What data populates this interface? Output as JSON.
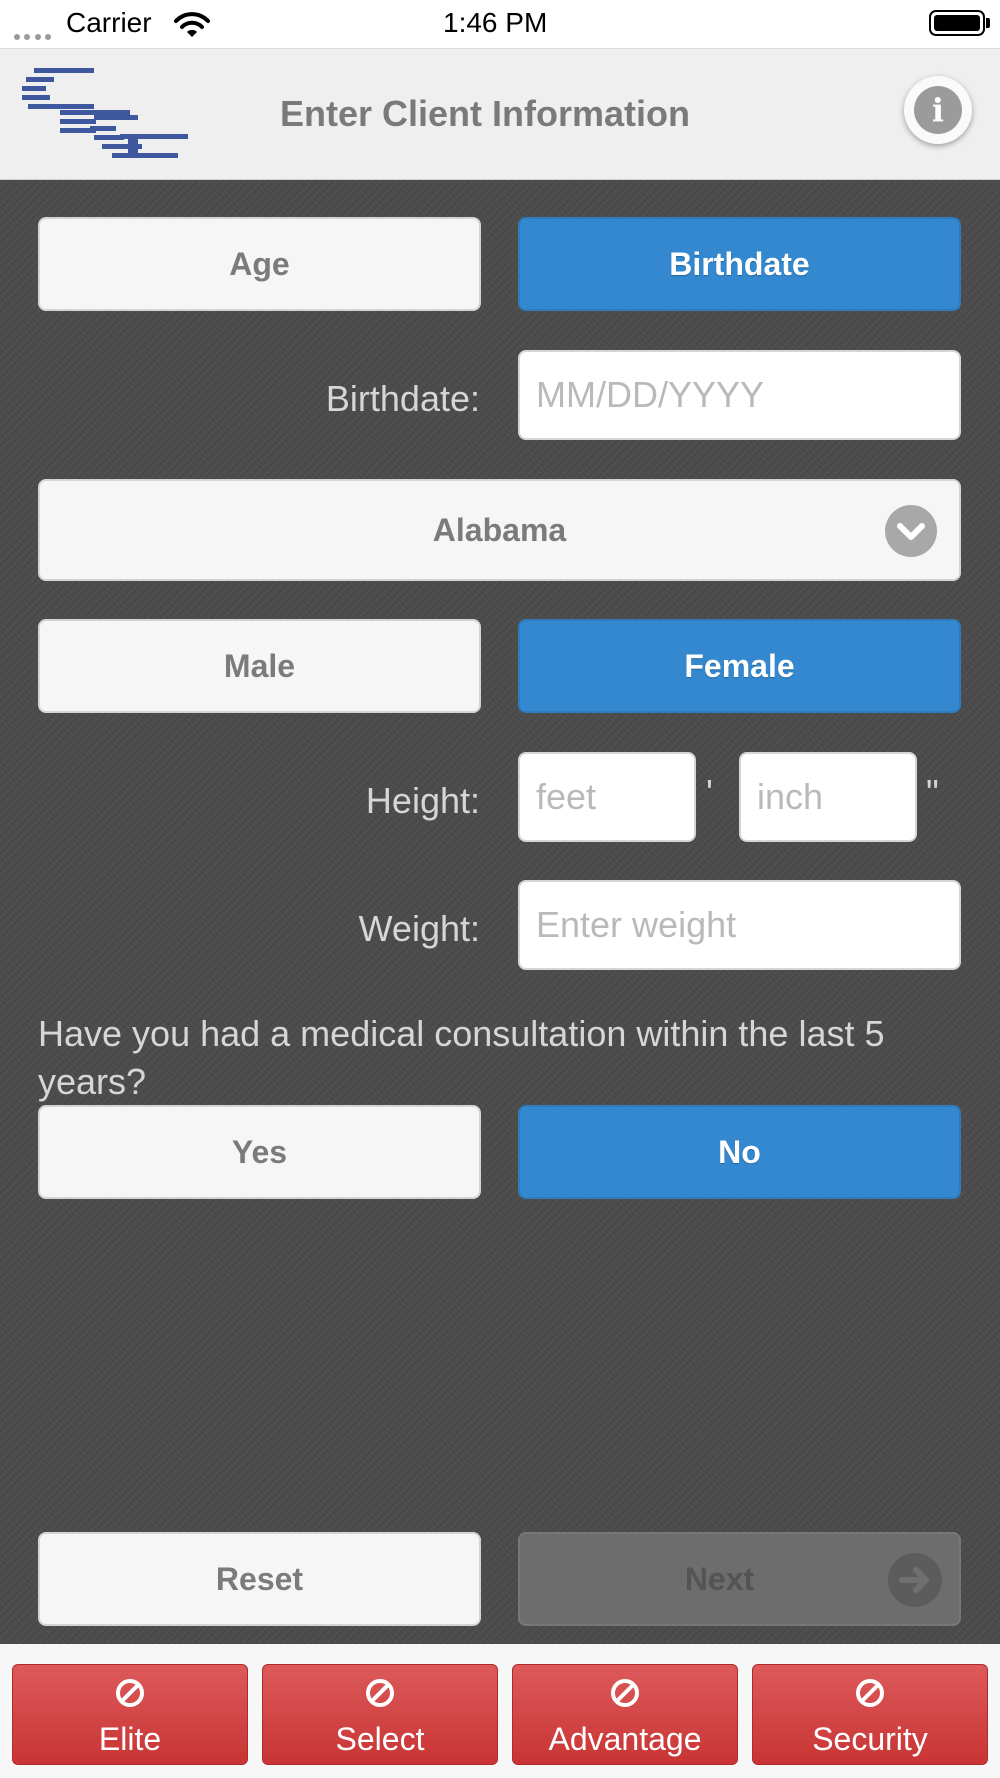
{
  "status_bar": {
    "carrier": "Carrier",
    "time": "1:46 PM"
  },
  "header": {
    "title": "Enter Client Information",
    "info_icon": "i"
  },
  "age_toggle": {
    "age_label": "Age",
    "birthdate_label": "Birthdate",
    "selected": "Birthdate"
  },
  "birthdate": {
    "label": "Birthdate:",
    "placeholder": "MM/DD/YYYY",
    "value": ""
  },
  "state": {
    "selected": "Alabama"
  },
  "gender": {
    "male_label": "Male",
    "female_label": "Female",
    "selected": "Female"
  },
  "height": {
    "label": "Height:",
    "feet_placeholder": "feet",
    "inch_placeholder": "inch",
    "feet_mark": "'",
    "inch_mark": "\""
  },
  "weight": {
    "label": "Weight:",
    "placeholder": "Enter weight"
  },
  "medical": {
    "question": "Have you had a medical consultation within the last 5 years?",
    "yes_label": "Yes",
    "no_label": "No",
    "selected": "No"
  },
  "actions": {
    "reset_label": "Reset",
    "next_label": "Next"
  },
  "tabs": [
    {
      "label": "Elite",
      "icon": "no-entry-icon"
    },
    {
      "label": "Select",
      "icon": "no-entry-icon"
    },
    {
      "label": "Advantage",
      "icon": "no-entry-icon"
    },
    {
      "label": "Security",
      "icon": "no-entry-icon"
    }
  ],
  "colors": {
    "accent": "#3488cf",
    "tab_red": "#d04040",
    "background": "#4a4a4a"
  }
}
